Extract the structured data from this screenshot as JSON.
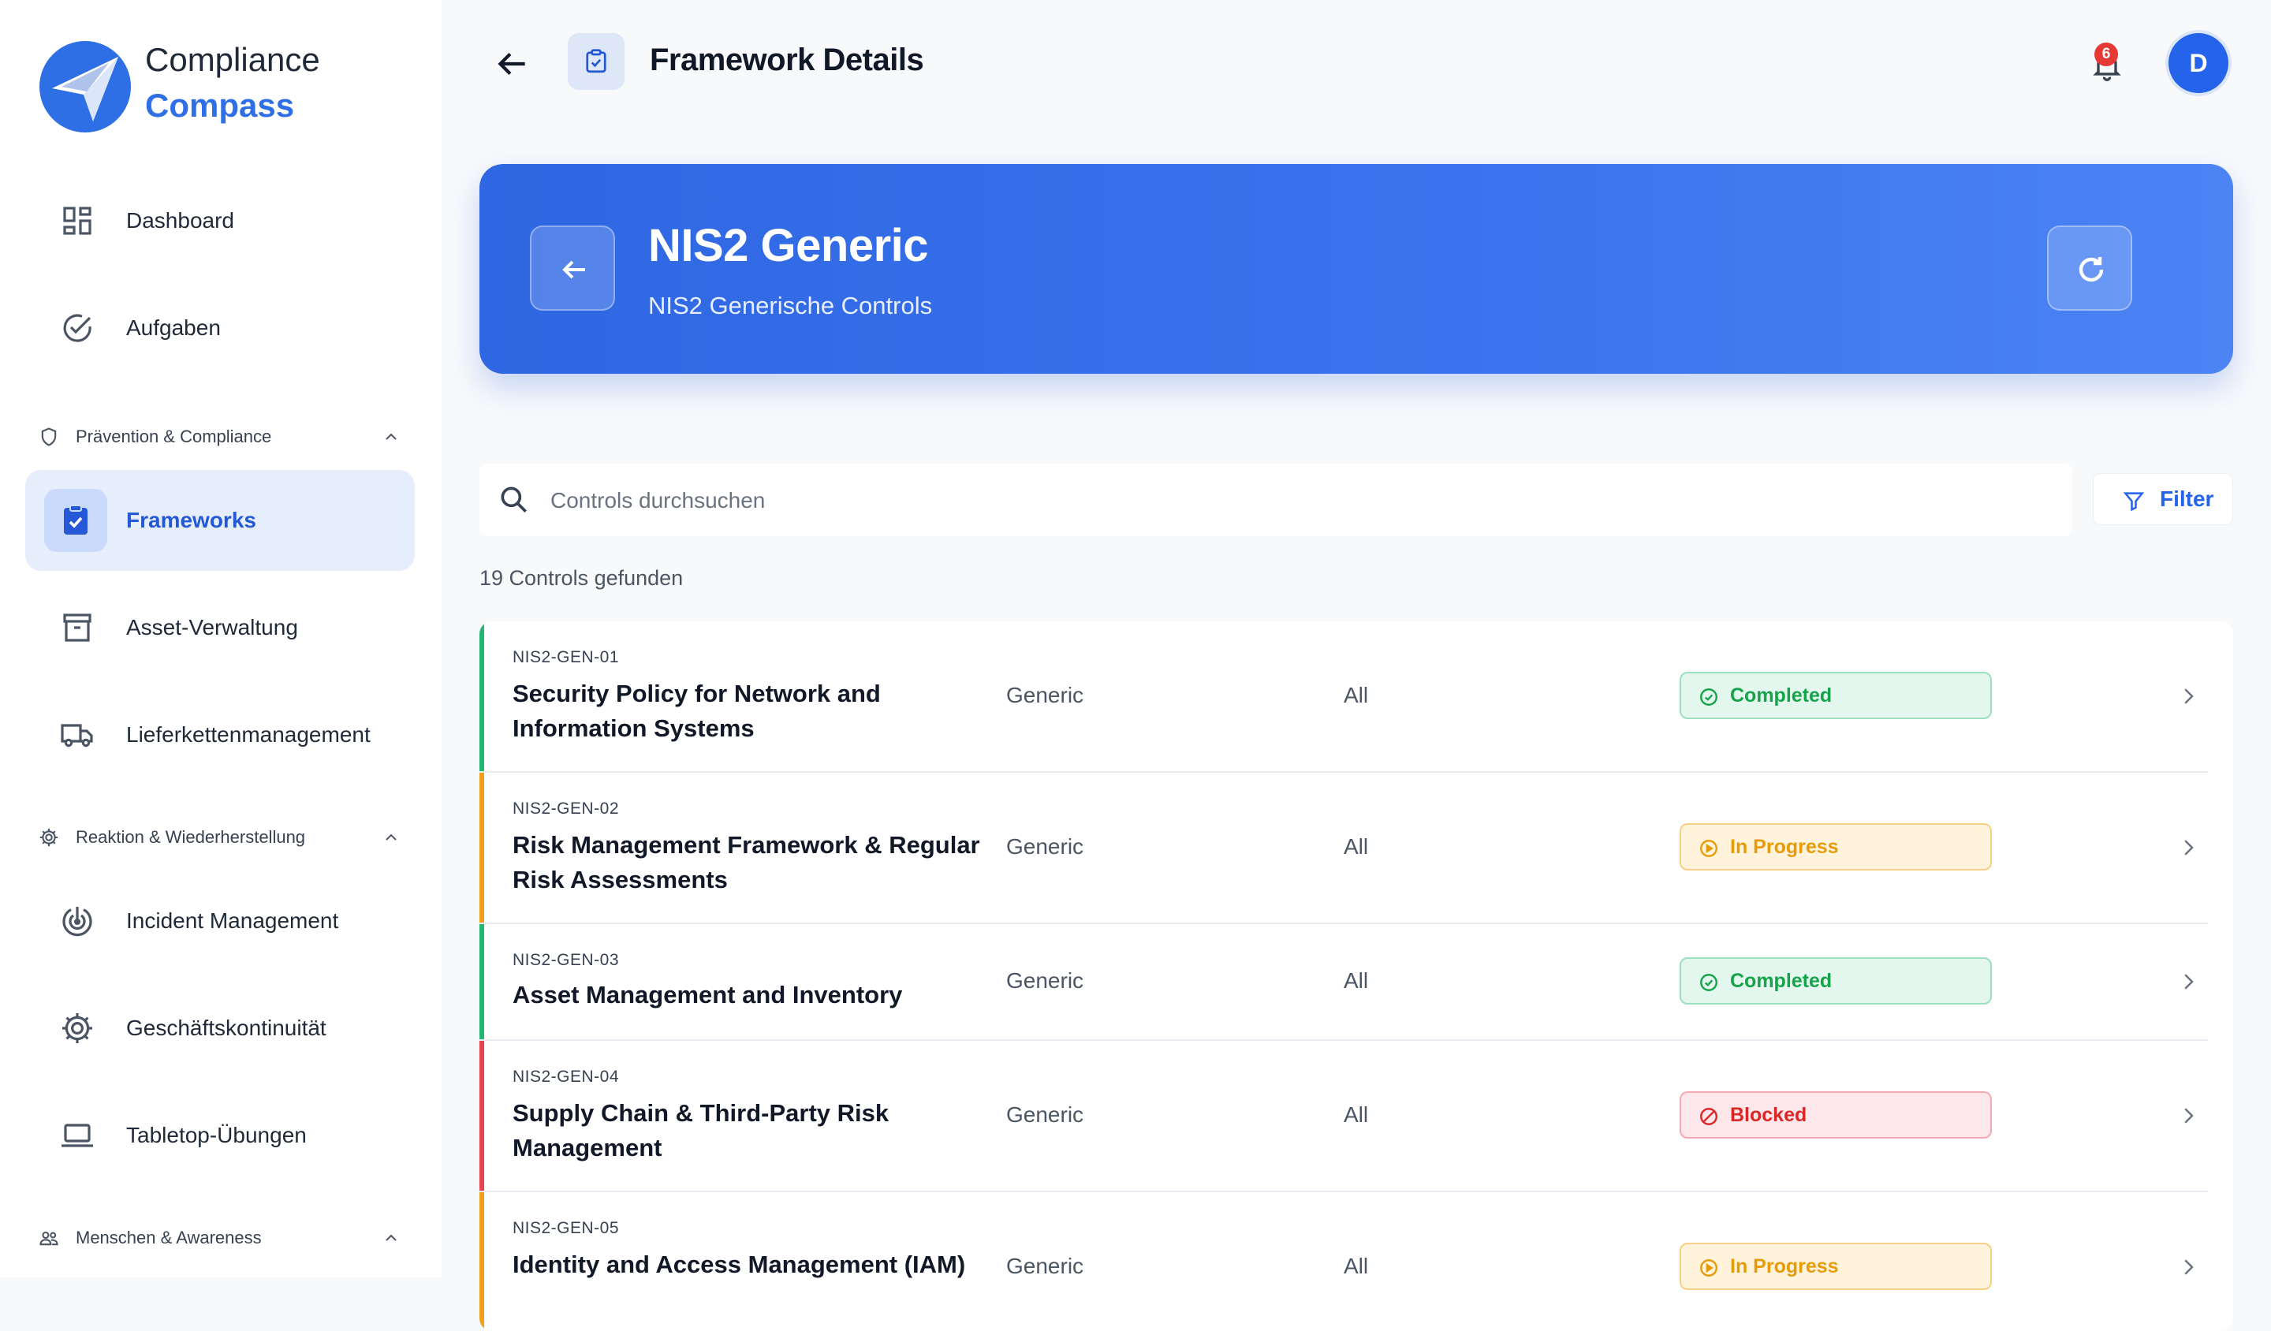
{
  "brand": {
    "line1": "Compliance",
    "line2": "Compass"
  },
  "sidebar": {
    "items": [
      {
        "label": "Dashboard",
        "icon": "dashboard-icon"
      },
      {
        "label": "Aufgaben",
        "icon": "check-circle-icon"
      },
      {
        "label": "Frameworks",
        "icon": "clipboard-check-icon",
        "active": true
      },
      {
        "label": "Asset-Verwaltung",
        "icon": "archive-icon"
      },
      {
        "label": "Lieferkettenmanagement",
        "icon": "truck-icon"
      },
      {
        "label": "Incident Management",
        "icon": "target-icon"
      },
      {
        "label": "Geschäftskontinuität",
        "icon": "gear-icon"
      },
      {
        "label": "Tabletop-Übungen",
        "icon": "laptop-icon"
      }
    ],
    "sections": [
      {
        "label": "Prävention & Compliance",
        "icon": "shield-icon"
      },
      {
        "label": "Reaktion & Wiederherstellung",
        "icon": "gear-icon"
      },
      {
        "label": "Menschen & Awareness",
        "icon": "people-icon"
      }
    ]
  },
  "header": {
    "title": "Framework Details",
    "notifications_count": "6",
    "avatar_initial": "D"
  },
  "banner": {
    "title": "NIS2 Generic",
    "subtitle": "NIS2 Generische Controls"
  },
  "search": {
    "placeholder": "Controls durchsuchen",
    "value": ""
  },
  "filter_label": "Filter",
  "result_count": "19 Controls gefunden",
  "controls": [
    {
      "id": "NIS2-GEN-01",
      "title": "Security Policy for Network and Information Systems",
      "category": "Generic",
      "scope": "All",
      "status": "Completed",
      "status_key": "completed"
    },
    {
      "id": "NIS2-GEN-02",
      "title": "Risk Management Framework & Regular Risk Assessments",
      "category": "Generic",
      "scope": "All",
      "status": "In Progress",
      "status_key": "inprogress"
    },
    {
      "id": "NIS2-GEN-03",
      "title": "Asset Management and Inventory",
      "category": "Generic",
      "scope": "All",
      "status": "Completed",
      "status_key": "completed"
    },
    {
      "id": "NIS2-GEN-04",
      "title": "Supply Chain & Third-Party Risk Management",
      "category": "Generic",
      "scope": "All",
      "status": "Blocked",
      "status_key": "blocked"
    },
    {
      "id": "NIS2-GEN-05",
      "title": "Identity and Access Management (IAM)",
      "category": "Generic",
      "scope": "All",
      "status": "In Progress",
      "status_key": "inprogress"
    }
  ],
  "colors": {
    "accent": "#2f6fe5",
    "completed": "#16a34a",
    "inprogress": "#f0a01a",
    "blocked": "#dc2626"
  }
}
